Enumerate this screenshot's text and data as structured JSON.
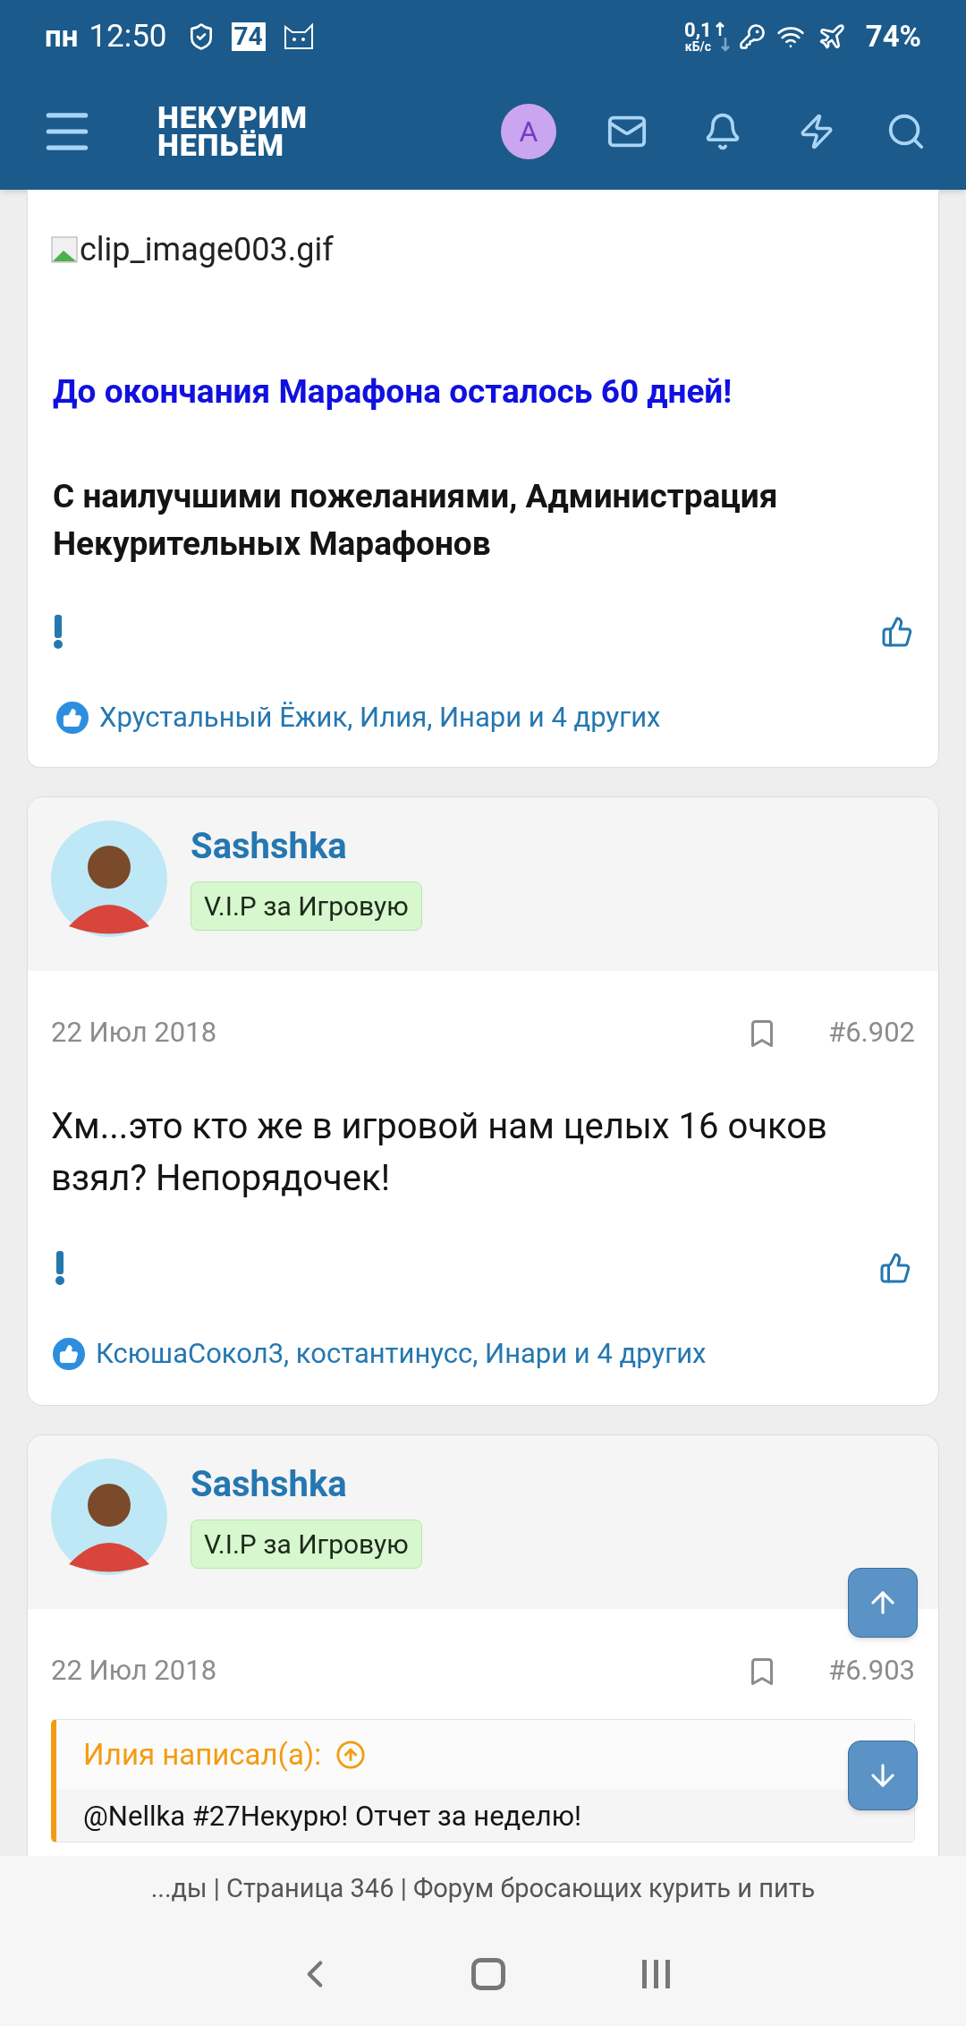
{
  "status_bar": {
    "day": "пн",
    "time": "12:50",
    "calendar_badge": "74",
    "net_speed": "0,1",
    "net_unit": "кБ/с",
    "battery": "74%"
  },
  "header": {
    "logo_line_1": "НЕКУРИМ",
    "logo_line_2": "НЕПЬЁМ",
    "avatar_letter": "A"
  },
  "posts": [
    {
      "kind": "continued",
      "image_alt": "clip_image003.gif",
      "highlight": "До окончания Марафона осталось 60 дней!",
      "closing": "С наилучшими пожеланиями, Администрация Некурительных Марафонов",
      "reactions": "Хрустальный Ёжик, Илия, Инари и 4 других"
    },
    {
      "kind": "full",
      "author": "Sashshka",
      "badge": "V.I.P за Игровую",
      "date": "22 Июл 2018",
      "number": "#6.902",
      "body": "Хм...это кто же в игровой нам целых 16 очков взял? Непорядочек!",
      "reactions": "КсюшаСокол3, костантинусс, Инари и 4 других"
    },
    {
      "kind": "quote",
      "author": "Sashshka",
      "badge": "V.I.P за Игровую",
      "date": "22 Июл 2018",
      "number": "#6.903",
      "quote_author": "Илия написал(а):",
      "quote_text": "@Nellka #27Некурю! Отчет за неделю!"
    }
  ],
  "page_title": "...ды | Страница 346 | Форум бросающих курить и пить"
}
